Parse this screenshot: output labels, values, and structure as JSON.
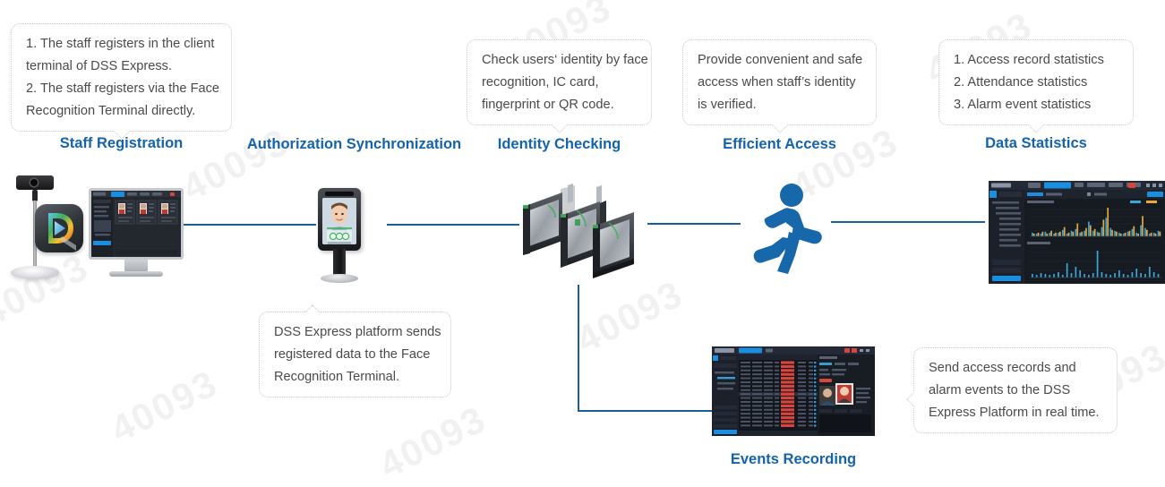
{
  "diagram": {
    "title": "DSS Express Face Recognition Access Control Workflow",
    "accent_color": "#1463ad",
    "line_color": "#1b5e9e",
    "watermark_text": "40093"
  },
  "stages": [
    {
      "id": "staff-registration",
      "label": "Staff Registration",
      "callout_lines": [
        "1. The staff registers in the client",
        "terminal of DSS Express.",
        "2. The staff registers via the Face",
        "Recognition Terminal directly."
      ]
    },
    {
      "id": "authorization-synchronization",
      "label": "Authorization Synchronization",
      "callout_lines": [
        "DSS Express platform sends",
        "registered data to the Face",
        "Recognition Terminal."
      ]
    },
    {
      "id": "identity-checking",
      "label": "Identity Checking",
      "callout_lines": [
        "Check users‘ identity by face",
        "recognition, IC card,",
        "fingerprint or QR code."
      ]
    },
    {
      "id": "efficient-access",
      "label": "Efficient Access",
      "callout_lines": [
        "Provide convenient and safe",
        "access when staff’s identity",
        "is verified."
      ]
    },
    {
      "id": "data-statistics",
      "label": "Data Statistics",
      "callout_lines": [
        "1. Access record statistics",
        "2. Attendance statistics",
        "3. Alarm event statistics"
      ]
    },
    {
      "id": "events-recording",
      "label": "Events Recording",
      "callout_lines": [
        "Send access records and",
        "alarm events to the DSS",
        "Express Platform in real time."
      ]
    }
  ],
  "devices": {
    "camera": "camera-on-stand-icon",
    "app_icon": "dss-express-app-icon",
    "client_monitor": "dss-express-client-monitor",
    "face_terminal": "face-recognition-terminal",
    "speed_gates": "speed-gate-turnstiles",
    "runner": "running-person-icon",
    "dashboard": "data-statistics-dashboard",
    "events_screen": "events-recording-screen"
  },
  "chart_data": {
    "type": "bar",
    "title": "Data Statistics dashboard",
    "charts": [
      {
        "name": "top-bar-chart",
        "series": [
          {
            "name": "series-blue",
            "color": "#3ba7d6",
            "values": [
              4,
              3,
              3,
              5,
              4,
              3,
              4,
              7,
              3,
              6,
              8,
              4,
              6,
              16,
              6,
              5,
              10,
              20,
              9,
              6,
              4,
              3,
              5,
              8,
              4,
              12,
              9,
              3,
              4,
              6
            ]
          },
          {
            "name": "series-orange",
            "color": "#e8a93c",
            "values": [
              3,
              4,
              5,
              3,
              6,
              4,
              5,
              10,
              4,
              5,
              14,
              5,
              9,
              12,
              8,
              4,
              18,
              31,
              7,
              5,
              3,
              4,
              6,
              11,
              3,
              22,
              7,
              4,
              3,
              5
            ]
          }
        ],
        "grid": true
      },
      {
        "name": "bottom-bar-chart",
        "series": [
          {
            "name": "series-blue",
            "color": "#3ba7d6",
            "values": [
              4,
              3,
              5,
              4,
              3,
              4,
              6,
              3,
              16,
              5,
              12,
              8,
              4,
              3,
              5,
              30,
              6,
              4,
              3,
              5,
              8,
              4,
              3,
              6,
              10,
              5,
              4,
              12,
              6,
              4
            ]
          }
        ],
        "grid": true
      }
    ]
  }
}
